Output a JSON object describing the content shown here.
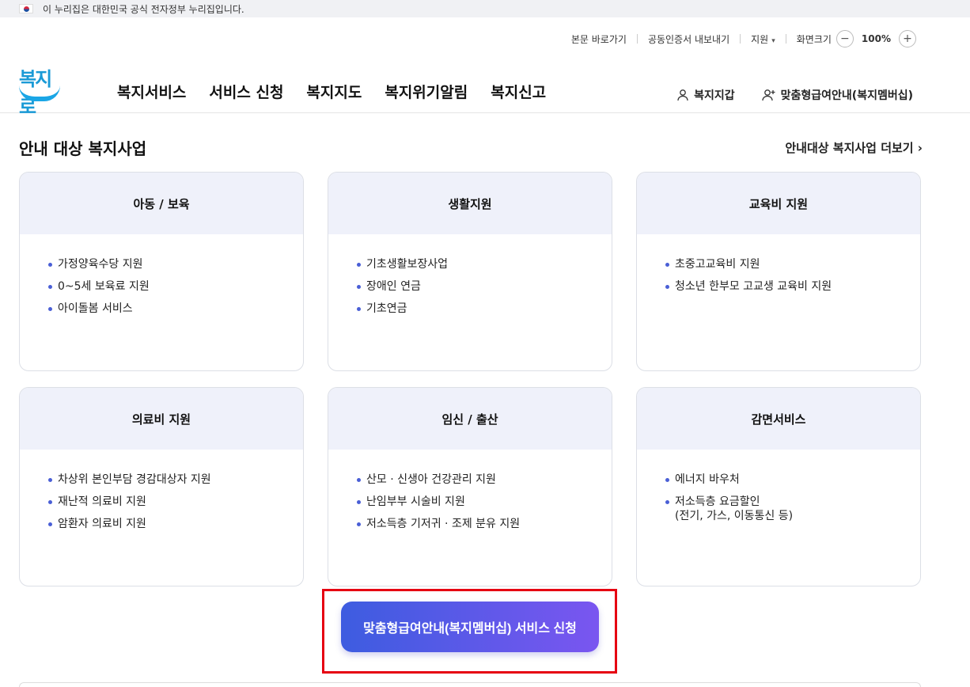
{
  "banner": {
    "text": "이 누리집은 대한민국 공식 전자정부 누리집입니다.",
    "flag_icon": "korea-flag-icon"
  },
  "util": {
    "skip_link": "본문 바로가기",
    "cert_export": "공동인증서 내보내기",
    "support": "지원",
    "zoom_label": "화면크기",
    "zoom_value": "100%",
    "zoom_out": "−",
    "zoom_in": "+"
  },
  "logo": {
    "text": "복지로"
  },
  "gnb": [
    "복지서비스",
    "서비스 신청",
    "복지지도",
    "복지위기알림",
    "복지신고"
  ],
  "right_menu": {
    "wallet": "복지지갑",
    "membership": "맞춤형급여안내(복지멤버십)"
  },
  "section": {
    "title": "안내 대상 복지사업",
    "more": "안내대상 복지사업 더보기 ›"
  },
  "cards": [
    {
      "title": "아동 / 보육",
      "items": [
        "가정양육수당 지원",
        "0~5세 보육료 지원",
        "아이돌봄 서비스"
      ]
    },
    {
      "title": "생활지원",
      "items": [
        "기초생활보장사업",
        "장애인 연금",
        "기초연금"
      ]
    },
    {
      "title": "교육비 지원",
      "items": [
        "초중고교육비 지원",
        "청소년 한부모 고교생 교육비 지원"
      ]
    },
    {
      "title": "의료비 지원",
      "items": [
        "차상위 본인부담 경감대상자 지원",
        "재난적 의료비 지원",
        "암환자 의료비 지원"
      ]
    },
    {
      "title": "임신 / 출산",
      "items": [
        "산모 · 신생아 건강관리 지원",
        "난임부부 시술비 지원",
        "저소득층 기저귀 · 조제 분유 지원"
      ]
    },
    {
      "title": "감면서비스",
      "items": [
        "에너지 바우처",
        "저소득층 요금할인\n(전기, 가스, 이동통신 등)"
      ]
    }
  ],
  "cta": {
    "label": "맞춤형급여안내(복지멤버십) 서비스 신청"
  },
  "colors": {
    "accent_start": "#3d5ce0",
    "accent_end": "#7a56f0",
    "highlight": "#e60012",
    "card_head": "#eff1fa"
  }
}
